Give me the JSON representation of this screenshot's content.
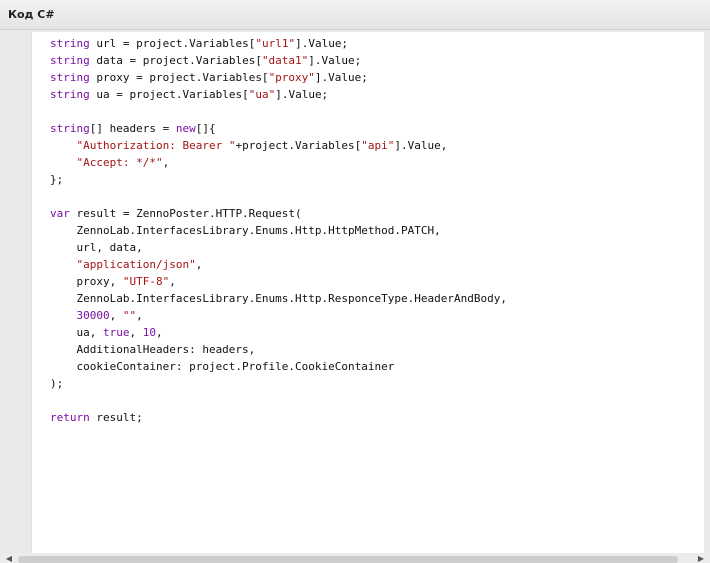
{
  "header": {
    "title": "Код C#"
  },
  "icons": {
    "scroll_left": "chevron-left-icon",
    "scroll_right": "chevron-right-icon"
  },
  "colors": {
    "keyword": "#7a0fa8",
    "string": "#a31515",
    "number": "#7a0fa8",
    "text": "#111111"
  },
  "code": {
    "language": "C#",
    "lines": [
      [
        [
          "kw",
          "string"
        ],
        [
          "t",
          " url = project.Variables["
        ],
        [
          "str",
          "\"url1\""
        ],
        [
          "t",
          "].Value;"
        ]
      ],
      [
        [
          "kw",
          "string"
        ],
        [
          "t",
          " data = project.Variables["
        ],
        [
          "str",
          "\"data1\""
        ],
        [
          "t",
          "].Value;"
        ]
      ],
      [
        [
          "kw",
          "string"
        ],
        [
          "t",
          " proxy = project.Variables["
        ],
        [
          "str",
          "\"proxy\""
        ],
        [
          "t",
          "].Value;"
        ]
      ],
      [
        [
          "kw",
          "string"
        ],
        [
          "t",
          " ua = project.Variables["
        ],
        [
          "str",
          "\"ua\""
        ],
        [
          "t",
          "].Value;"
        ]
      ],
      [],
      [
        [
          "kw",
          "string"
        ],
        [
          "t",
          "[] headers = "
        ],
        [
          "kw",
          "new"
        ],
        [
          "t",
          "[]{"
        ]
      ],
      [
        [
          "t",
          "    "
        ],
        [
          "str",
          "\"Authorization: Bearer \""
        ],
        [
          "t",
          "+project.Variables["
        ],
        [
          "str",
          "\"api\""
        ],
        [
          "t",
          "].Value,"
        ]
      ],
      [
        [
          "t",
          "    "
        ],
        [
          "str",
          "\"Accept: */*\""
        ],
        [
          "t",
          ","
        ]
      ],
      [
        [
          "t",
          "};"
        ]
      ],
      [],
      [
        [
          "kw",
          "var"
        ],
        [
          "t",
          " result = ZennoPoster.HTTP.Request("
        ]
      ],
      [
        [
          "t",
          "    ZennoLab.InterfacesLibrary.Enums.Http.HttpMethod.PATCH,"
        ]
      ],
      [
        [
          "t",
          "    url, data,"
        ]
      ],
      [
        [
          "t",
          "    "
        ],
        [
          "str",
          "\"application/json\""
        ],
        [
          "t",
          ","
        ]
      ],
      [
        [
          "t",
          "    proxy, "
        ],
        [
          "str",
          "\"UTF-8\""
        ],
        [
          "t",
          ","
        ]
      ],
      [
        [
          "t",
          "    ZennoLab.InterfacesLibrary.Enums.Http.ResponceType.HeaderAndBody,"
        ]
      ],
      [
        [
          "t",
          "    "
        ],
        [
          "num",
          "30000"
        ],
        [
          "t",
          ", "
        ],
        [
          "str",
          "\"\""
        ],
        [
          "t",
          ","
        ]
      ],
      [
        [
          "t",
          "    ua, "
        ],
        [
          "kw",
          "true"
        ],
        [
          "t",
          ", "
        ],
        [
          "num",
          "10"
        ],
        [
          "t",
          ","
        ]
      ],
      [
        [
          "t",
          "    AdditionalHeaders: headers,"
        ]
      ],
      [
        [
          "t",
          "    cookieContainer: project.Profile.CookieContainer"
        ]
      ],
      [
        [
          "t",
          ");"
        ]
      ],
      [],
      [
        [
          "kw",
          "return"
        ],
        [
          "t",
          " result;"
        ]
      ]
    ]
  }
}
